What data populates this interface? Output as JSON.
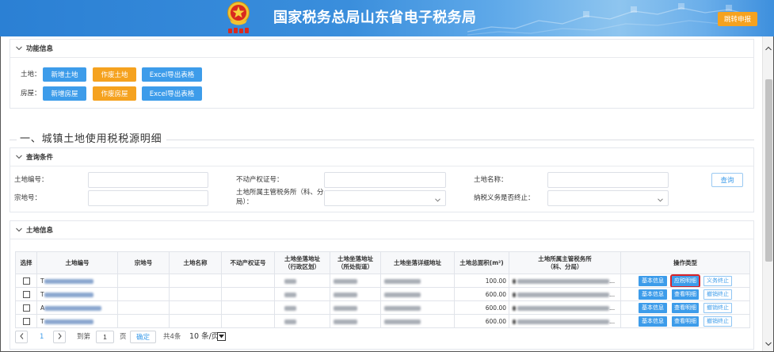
{
  "colors": {
    "header_bg_start": "#2b80d4",
    "header_bg_end": "#8ec5ef",
    "primary": "#3d9cea",
    "warning": "#f5a21f",
    "highlight": "#d8232a"
  },
  "icons": {
    "section_toggle": "chevron-down-icon",
    "select_arrow": "chevron-down-icon",
    "scroll_up": "chevron-up-icon",
    "scroll_down": "chevron-down-icon",
    "page_prev": "chevron-left-icon",
    "page_next": "chevron-right-icon",
    "logo": "tax-emblem-icon"
  },
  "header": {
    "title": "国家税务总局山东省电子税务局",
    "jump_button": "跳转申报"
  },
  "function_section": {
    "title": "功能信息",
    "land": {
      "label": "土地：",
      "buttons": [
        "新增土地",
        "作废土地",
        "Excel导出表格"
      ]
    },
    "house": {
      "label": "房屋：",
      "buttons": [
        "新增房屋",
        "作废房屋",
        "Excel导出表格"
      ]
    }
  },
  "detail_heading": "一、城镇土地使用税税源明细",
  "query": {
    "title": "查询条件",
    "land_no_label": "土地编号：",
    "cert_no_label": "不动产权证号：",
    "land_name_label": "土地名称：",
    "parcel_no_label": "宗地号：",
    "tax_office_label": "土地所属主管税务所（科、分局）：",
    "terminated_label": "纳税义务是否终止：",
    "search_button": "查询"
  },
  "land_info": {
    "title": "土地信息",
    "columns": {
      "select": "选择",
      "land_no": "土地编号",
      "parcel_no": "宗地号",
      "land_name": "土地名称",
      "cert_no": "不动产权证号",
      "addr_region": [
        "土地坐落地址",
        "（行政区划）"
      ],
      "addr_street": [
        "土地坐落地址",
        "（所处街道）"
      ],
      "addr_detail": "土地坐落详细地址",
      "area": "土地总面积(m²)",
      "tax_office": [
        "土地所属主管税务所",
        "（科、分局）"
      ],
      "actions": "操作类型"
    },
    "rows": [
      {
        "checked": false,
        "land_no_prefix": "T",
        "area": "100.00",
        "tax_office_tail": "...",
        "actions": [
          "基本信息",
          "应税明细",
          "义务终止"
        ]
      },
      {
        "checked": false,
        "land_no_prefix": "T",
        "area": "600.00",
        "tax_office_tail": "...",
        "actions": [
          "基本信息",
          "查看明细",
          "撤销终止"
        ]
      },
      {
        "checked": false,
        "land_no_prefix": "A",
        "area": "600.00",
        "tax_office_tail": "...",
        "actions": [
          "基本信息",
          "查看明细",
          "撤销终止"
        ]
      },
      {
        "checked": false,
        "land_no_prefix": "T",
        "area": "600.00",
        "tax_office_tail": "...",
        "actions": [
          "基本信息",
          "查看明细",
          "撤销终止"
        ]
      }
    ]
  },
  "pagination": {
    "current_page": "1",
    "goto_label": "到第",
    "goto_value": "1",
    "page_unit": "页",
    "confirm": "确定",
    "total": "共4条",
    "page_size": "10 条/页"
  }
}
